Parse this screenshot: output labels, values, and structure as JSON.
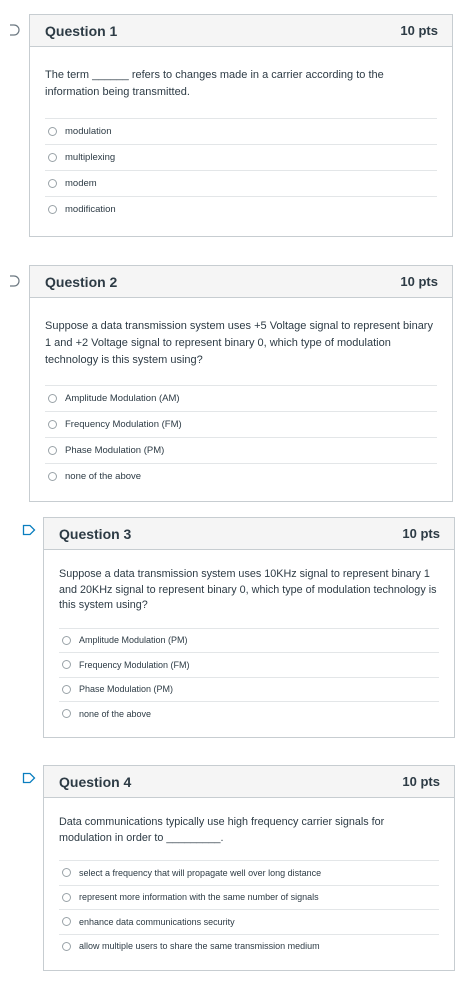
{
  "questions": [
    {
      "title": "Question 1",
      "points": "10 pts",
      "text": "The term ______ refers to changes made in a carrier according to the information being transmitted.",
      "answers": [
        "modulation",
        "multiplexing",
        "modem",
        "modification"
      ]
    },
    {
      "title": "Question 2",
      "points": "10 pts",
      "text": "Suppose a data transmission system uses +5 Voltage signal to represent binary 1 and +2 Voltage signal to represent binary 0, which type of modulation technology is this system using?",
      "answers": [
        "Amplitude Modulation (AM)",
        "Frequency Modulation (FM)",
        "Phase Modulation (PM)",
        "none of the above"
      ]
    },
    {
      "title": "Question 3",
      "points": "10 pts",
      "text": "Suppose a data transmission system uses 10KHz signal to represent binary 1 and 20KHz signal to represent binary 0, which type of modulation technology is this system using?",
      "answers": [
        "Amplitude Modulation (PM)",
        "Frequency Modulation (FM)",
        "Phase Modulation (PM)",
        "none of the above"
      ]
    },
    {
      "title": "Question 4",
      "points": "10 pts",
      "text": "Data communications typically use high frequency carrier signals for modulation in order to _________.",
      "answers": [
        "select a frequency that will propagate well over long distance",
        "represent more information with the same number of signals",
        "enhance data communications security",
        "allow multiple users to share the same transmission medium"
      ]
    }
  ]
}
